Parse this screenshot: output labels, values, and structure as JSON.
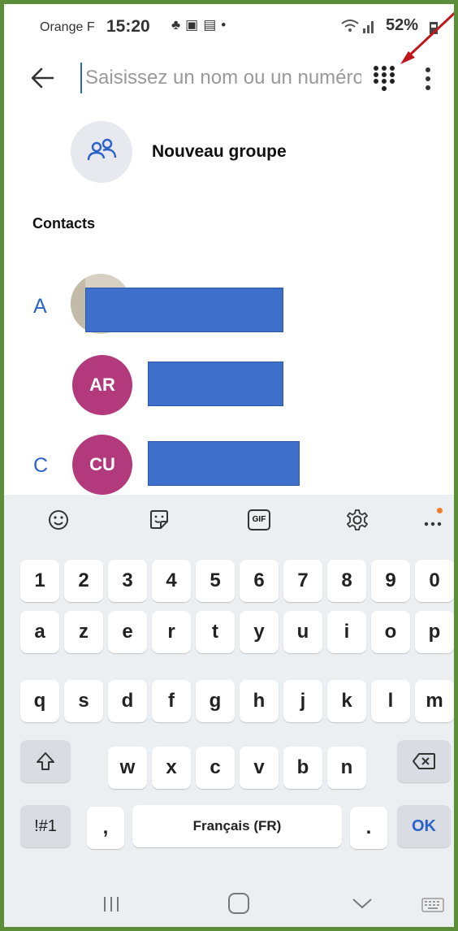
{
  "status_bar": {
    "carrier": "Orange F",
    "time": "15:20",
    "icons": [
      "notification-icon",
      "gallery-icon",
      "mail-icon",
      "dot-icon"
    ],
    "signal": "wifi-signal-icon",
    "battery": "52%"
  },
  "search": {
    "placeholder": "Saisissez un nom ou un numéro"
  },
  "new_group": {
    "label": "Nouveau groupe"
  },
  "contacts": {
    "header": "Contacts",
    "sections": [
      {
        "letter": "A",
        "items": [
          {
            "initials": "",
            "avatar": "photo"
          },
          {
            "initials": "AR",
            "avatar": "initials"
          }
        ]
      },
      {
        "letter": "C",
        "items": [
          {
            "initials": "CU",
            "avatar": "initials"
          }
        ]
      }
    ]
  },
  "keyboard": {
    "toolbar": [
      "emoji-icon",
      "sticker-icon",
      "gif-icon",
      "settings-icon",
      "more-icon"
    ],
    "gif_label": "GIF",
    "row_numbers": [
      "1",
      "2",
      "3",
      "4",
      "5",
      "6",
      "7",
      "8",
      "9",
      "0"
    ],
    "row_1": [
      "a",
      "z",
      "e",
      "r",
      "t",
      "y",
      "u",
      "i",
      "o",
      "p"
    ],
    "row_2": [
      "q",
      "s",
      "d",
      "f",
      "g",
      "h",
      "j",
      "k",
      "l",
      "m"
    ],
    "row_3": [
      "w",
      "x",
      "c",
      "v",
      "b",
      "n"
    ],
    "symbols_key": "!#1",
    "comma_key": ",",
    "space_label": "Français (FR)",
    "period_key": ".",
    "ok_key": "OK"
  },
  "colors": {
    "frame": "#5c8e3a",
    "accent": "#2a62c8",
    "avatar": "#b23a7c",
    "redaction": "#3d6fcb",
    "annotation_arrow": "#c0161c"
  }
}
